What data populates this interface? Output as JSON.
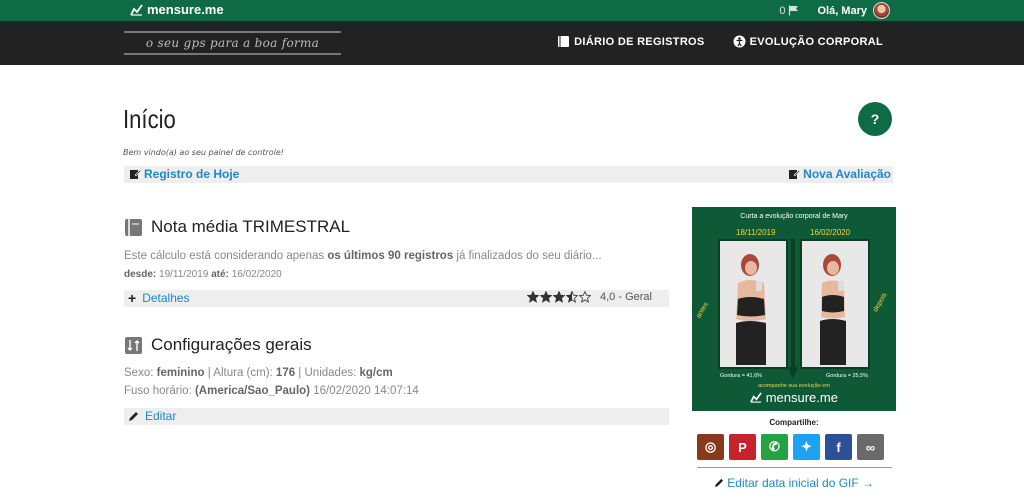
{
  "topbar": {
    "brand": "mensure.me",
    "notifications": "0",
    "greeting": "Olá, Mary"
  },
  "navbar": {
    "tagline": "o seu gps para a boa forma",
    "links": [
      "DIÁRIO DE REGISTROS",
      "EVOLUÇÃO CORPORAL"
    ]
  },
  "page": {
    "title": "Início",
    "help": "?",
    "welcome": "Bem vindo(a) ao seu painel de controle!",
    "quick_left": "Registro de Hoje",
    "quick_right": "Nova Avaliação"
  },
  "nota": {
    "title": "Nota média TRIMESTRAL",
    "desc_prefix": "Este cálculo está considerando apenas ",
    "desc_bold": "os últimos 90 registros",
    "desc_suffix": " já finalizados do seu diário...",
    "from_label": "desde:",
    "from": "19/11/2019",
    "to_label": "até:",
    "to": "16/02/2020",
    "details_link": "Detalhes",
    "rating_value": 3.5,
    "rating_label": "4,0 - Geral"
  },
  "config": {
    "title": "Configurações gerais",
    "sexo_label": "Sexo:",
    "sexo": "feminino",
    "altura_label": "Altura (cm):",
    "altura": "176",
    "unidades_label": "Unidades:",
    "unidades": "kg/cm",
    "fuso_label": "Fuso horário:",
    "fuso": "(America/Sao_Paulo)",
    "fuso_time": "16/02/2020 14:07:14",
    "edit_link": "Editar"
  },
  "gif": {
    "title": "Curta a evolução corporal de Mary",
    "date_before": "18/11/2019",
    "date_after": "16/02/2020",
    "side_before": "antes",
    "side_after": "depois",
    "fat_before": "Gordura = 41,6%",
    "fat_after": "Gordura = 25,5%",
    "follow": "acompanhe sua evolução em",
    "brand": "mensure.me"
  },
  "share": {
    "label": "Compartilhe:",
    "buttons": [
      {
        "name": "instagram",
        "color": "#8a3a1c",
        "glyph": "◎"
      },
      {
        "name": "pinterest",
        "color": "#c8232c",
        "glyph": "P"
      },
      {
        "name": "whatsapp",
        "color": "#25a244",
        "glyph": "✆"
      },
      {
        "name": "twitter",
        "color": "#1da1f2",
        "glyph": "✦"
      },
      {
        "name": "facebook",
        "color": "#2d4f96",
        "glyph": "f"
      },
      {
        "name": "link",
        "color": "#6a6a6a",
        "glyph": "∞"
      }
    ],
    "edit_gif": "Editar data inicial do GIF →"
  },
  "colors": {
    "brand_green": "#0e6b45",
    "link_blue": "#1e88c8"
  }
}
